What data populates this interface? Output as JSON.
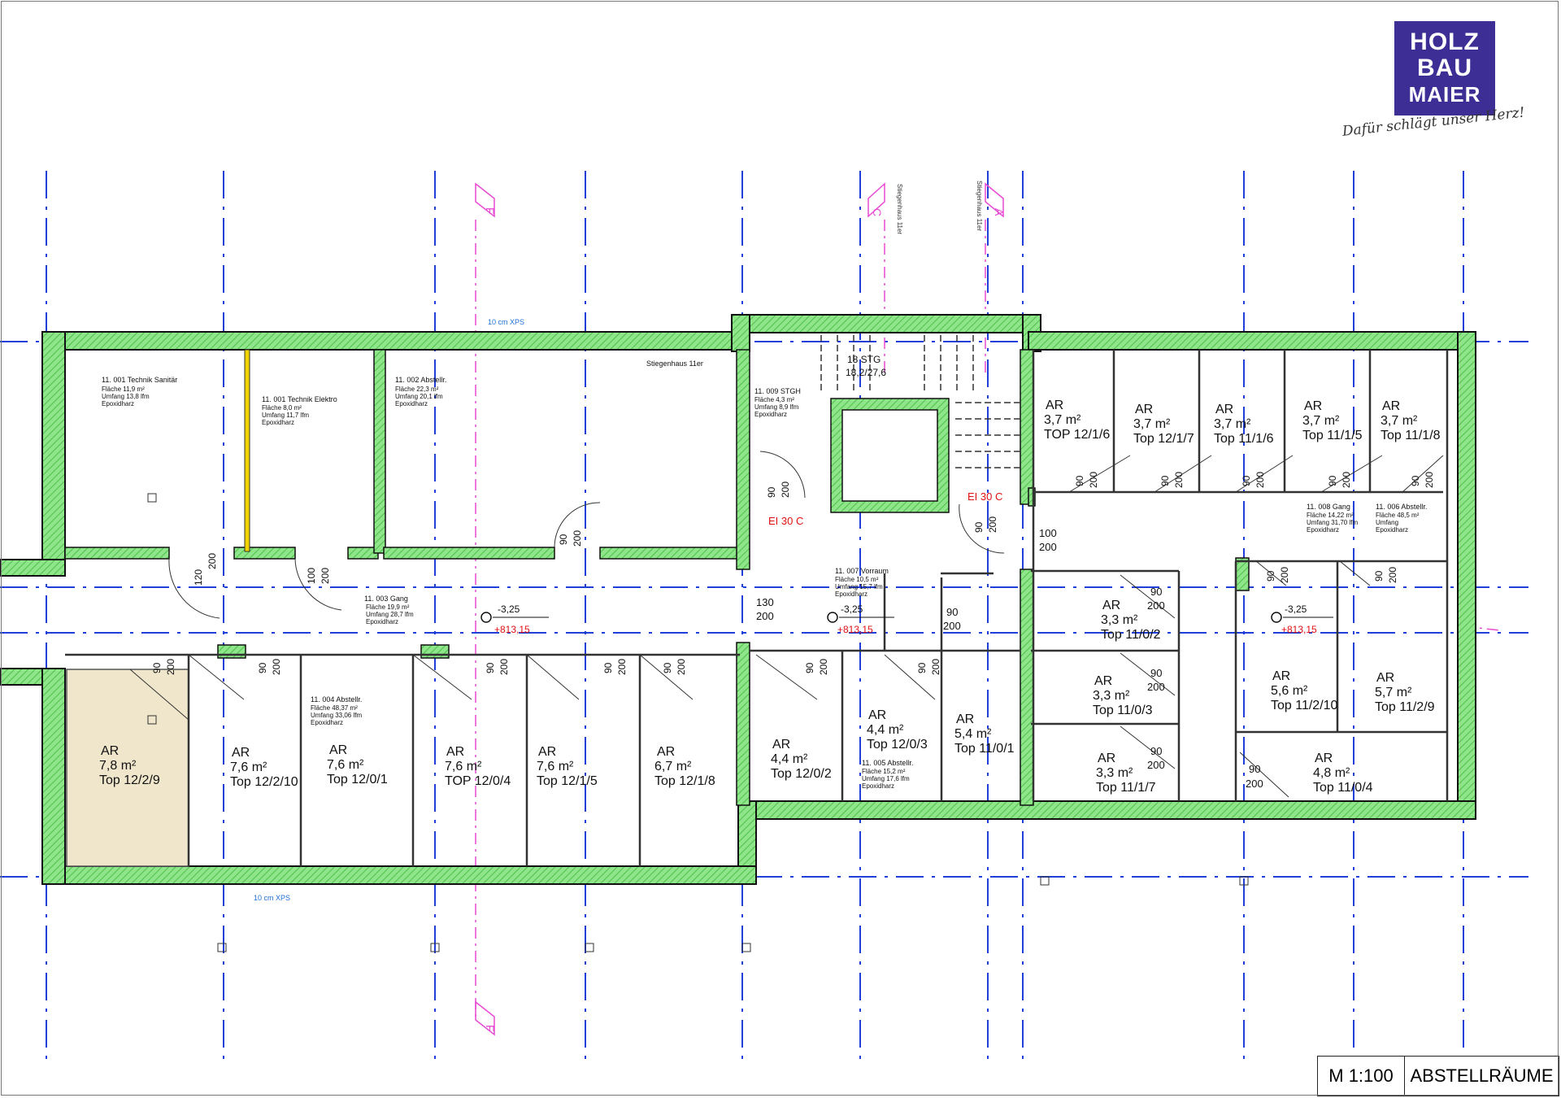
{
  "title_block": {
    "scale": "M 1:100",
    "title": "ABSTELLRÄUME"
  },
  "logo": {
    "line1": "HOLZ",
    "line2": "BAU",
    "line3": "MAIER",
    "slogan": "Dafür schlägt unser Herz!"
  },
  "colors": {
    "wall_fill": "#7fe07a",
    "grid_line": "#1f3fd8",
    "section_line": "#e84ad4",
    "highlight_room": "#efe6cc",
    "fire_rating_text": "#e01010"
  },
  "insulation_labels": {
    "top": "10 cm XPS",
    "bottom": "10 cm XPS"
  },
  "sections": {
    "f_top": "F",
    "f_bottom": "F",
    "c_mark": "C",
    "a_mark": "A",
    "stair_c_label": "Stiegenhaus 11er",
    "stair_a_label": "Stiegenhaus 11er",
    "stair_inside_label": "Stiegenhaus 11er"
  },
  "stair": {
    "steps": "18 STG",
    "dimensions": "18,2/27,6"
  },
  "fire_ratings": [
    "EI 30 C",
    "EI 30 C"
  ],
  "levels": [
    {
      "rel": "-3,25",
      "abs": "+813,15"
    },
    {
      "rel": "-3,25",
      "abs": "+813,15"
    },
    {
      "rel": "-3,25",
      "abs": "+813,15"
    }
  ],
  "room_tags": [
    {
      "name": "11. 001 Technik Sanitär",
      "area": "Fläche     11,9 m²",
      "perimeter": "Umfang    13,8 lfm",
      "floor": "Epoxidharz"
    },
    {
      "name": "11. 001 Technik Elektro",
      "area": "Fläche     8,0 m²",
      "perimeter": "Umfang    11,7 lfm",
      "floor": "Epoxidharz"
    },
    {
      "name": "11. 002 Abstellr.",
      "area": "Fläche     22,3 m²",
      "perimeter": "Umfang    20,1 lfm",
      "floor": "Epoxidharz"
    },
    {
      "name": "11. 003 Gang",
      "area": "Fläche     19,9 m²",
      "perimeter": "Umfang    28,7 lfm",
      "floor": "Epoxidharz"
    },
    {
      "name": "11. 004 Abstellr.",
      "area": "Fläche     48,37 m²",
      "perimeter": "Umfang    33,06 lfm",
      "floor": "Epoxidharz"
    },
    {
      "name": "11. 009 STGH",
      "area": "Fläche     4,3 m²",
      "perimeter": "Umfang    8,9 lfm",
      "floor": "Epoxidharz"
    },
    {
      "name": "11. 007 Vorraum",
      "area": "Fläche     10,5 m²",
      "perimeter": "Umfang    15,7 lfm",
      "floor": "Epoxidharz"
    },
    {
      "name": "11. 005 Abstellr.",
      "area": "Fläche     15,2 m²",
      "perimeter": "Umfang    17,6 lfm",
      "floor": "Epoxidharz"
    },
    {
      "name": "11. 008 Gang",
      "area": "Fläche     14,22 m²",
      "perimeter": "Umfang    31,70 lfm",
      "floor": "Epoxidharz"
    },
    {
      "name": "11. 006 Abstellr.",
      "area": "Fläche     48,5 m²",
      "perimeter": "Umfang    ",
      "floor": "Epoxidharz"
    }
  ],
  "storage_units": [
    {
      "type": "AR",
      "area": "7,8 m²",
      "top": "Top 12/2/9"
    },
    {
      "type": "AR",
      "area": "7,6 m²",
      "top": "Top 12/2/10"
    },
    {
      "type": "AR",
      "area": "7,6 m²",
      "top": "Top 12/0/1"
    },
    {
      "type": "AR",
      "area": "7,6 m²",
      "top": "TOP 12/0/4"
    },
    {
      "type": "AR",
      "area": "7,6 m²",
      "top": "Top 12/1/5"
    },
    {
      "type": "AR",
      "area": "6,7 m²",
      "top": "Top 12/1/8"
    },
    {
      "type": "AR",
      "area": "4,4 m²",
      "top": "Top 12/0/2"
    },
    {
      "type": "AR",
      "area": "4,4 m²",
      "top": "Top 12/0/3"
    },
    {
      "type": "AR",
      "area": "5,4 m²",
      "top": "Top 11/0/1"
    },
    {
      "type": "AR",
      "area": "3,7 m²",
      "top": "TOP 12/1/6"
    },
    {
      "type": "AR",
      "area": "3,7 m²",
      "top": "Top 12/1/7"
    },
    {
      "type": "AR",
      "area": "3,7 m²",
      "top": "Top 11/1/6"
    },
    {
      "type": "AR",
      "area": "3,7 m²",
      "top": "Top 11/1/5"
    },
    {
      "type": "AR",
      "area": "3,7 m²",
      "top": "Top 11/1/8"
    },
    {
      "type": "AR",
      "area": "3,3 m²",
      "top": "Top 11/0/2"
    },
    {
      "type": "AR",
      "area": "3,3 m²",
      "top": "Top 11/0/3"
    },
    {
      "type": "AR",
      "area": "3,3 m²",
      "top": "Top 11/1/7"
    },
    {
      "type": "AR",
      "area": "5,6 m²",
      "top": "Top 11/2/10"
    },
    {
      "type": "AR",
      "area": "5,7 m²",
      "top": "Top 11/2/9"
    },
    {
      "type": "AR",
      "area": "4,8 m²",
      "top": "Top 11/0/4"
    }
  ],
  "door_dims": {
    "d90": "90",
    "d100": "100",
    "d120": "120",
    "d130": "130",
    "d200": "200"
  }
}
